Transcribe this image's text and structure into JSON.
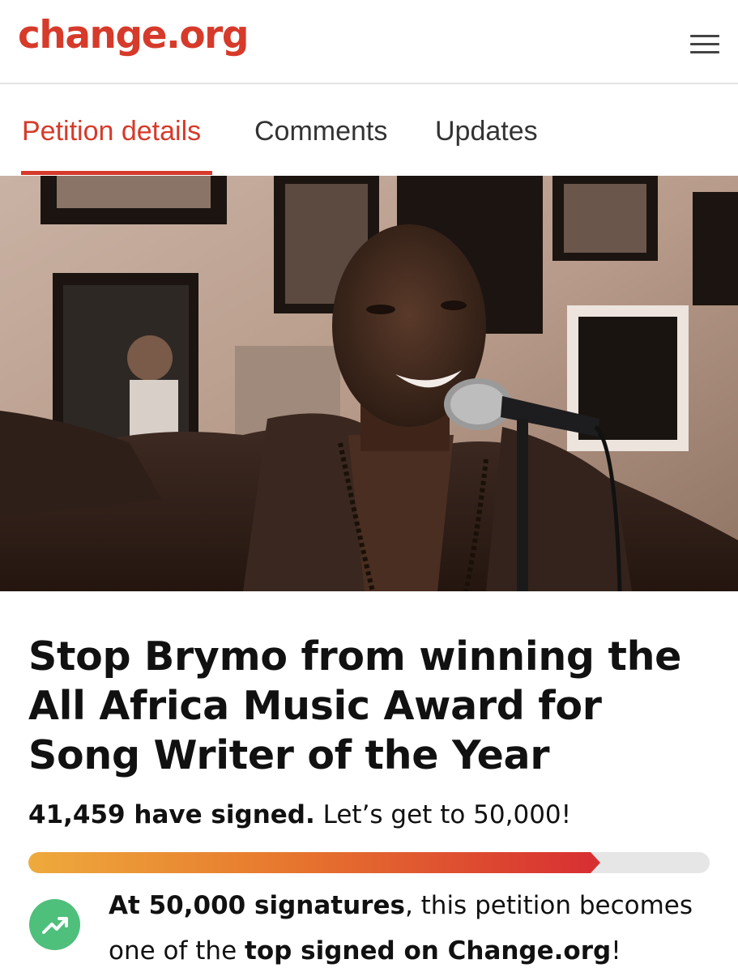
{
  "header": {
    "logo_text": "change.org",
    "brand_color": "#d63a2a",
    "menu_icon": "hamburger-menu-icon"
  },
  "tabs": [
    {
      "label": "Petition details",
      "active": true
    },
    {
      "label": "Comments",
      "active": false
    },
    {
      "label": "Updates",
      "active": false
    }
  ],
  "hero": {
    "image": "photo of a smiling man singing into a microphone in front of framed pictures on a wall"
  },
  "petition": {
    "title": "Stop Brymo from winning the All Africa Music Award for Song Writer of the Year",
    "signed_count_text": "41,459 have signed.",
    "goal_text": " Let’s get to 50,000!",
    "signed_count": 41459,
    "goal": 50000,
    "progress_fraction": 0.84
  },
  "milestone": {
    "icon": "trending-up-icon",
    "icon_color": "#4fbf7c",
    "bold_1": "At 50,000 signatures",
    "text_1": ", this petition becomes one of the ",
    "bold_2": "top signed on Change.org",
    "text_2": "!"
  }
}
